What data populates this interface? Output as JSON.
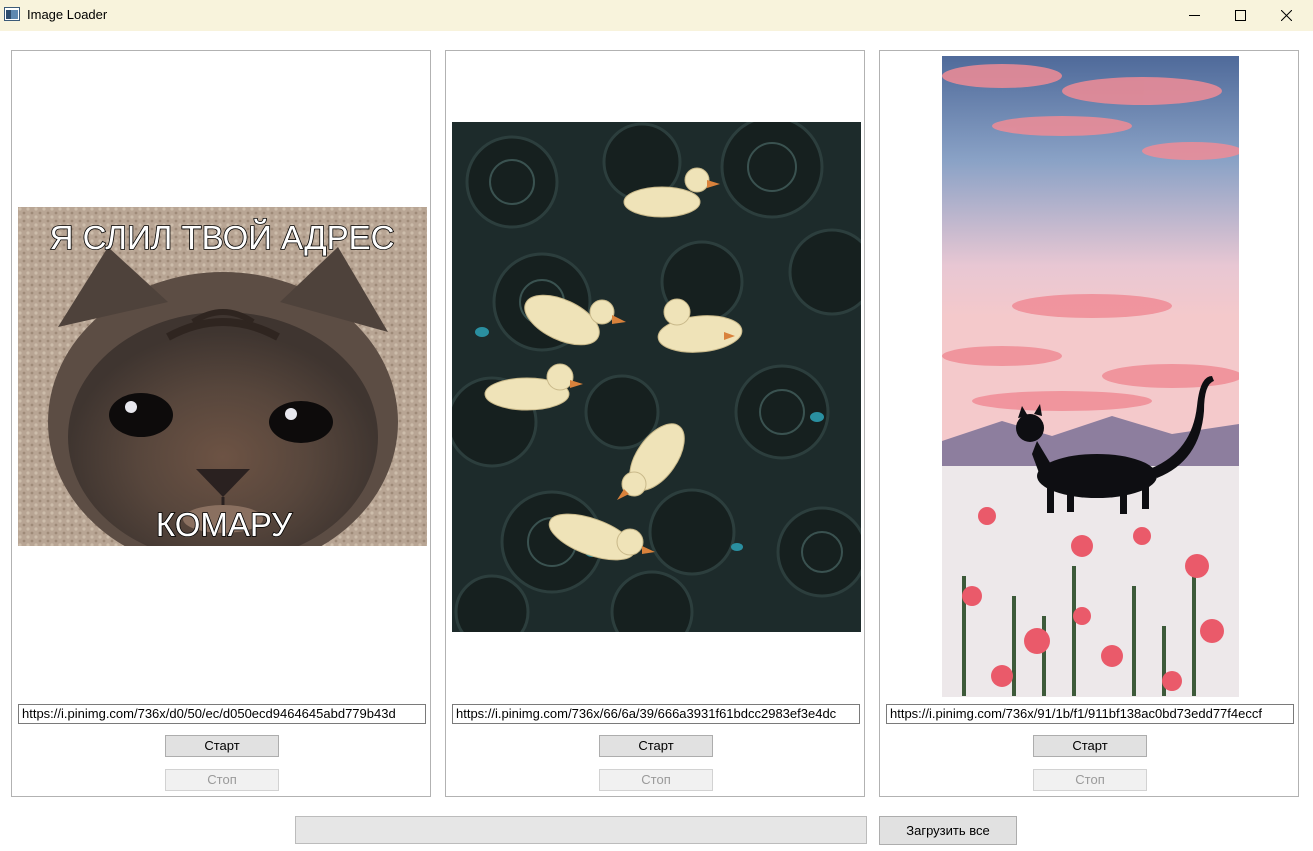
{
  "window": {
    "title": "Image Loader"
  },
  "panels": [
    {
      "url": "https://i.pinimg.com/736x/d0/50/ec/d050ecd9464645abd779b43d",
      "start_label": "Старт",
      "stop_label": "Стоп",
      "image_caption_top": "Я СЛИЛ ТВОЙ АДРЕС",
      "image_caption_bottom": "КОМАРУ"
    },
    {
      "url": "https://i.pinimg.com/736x/66/6a/39/666a3931f61bdcc2983ef3e4dc",
      "start_label": "Старт",
      "stop_label": "Стоп"
    },
    {
      "url": "https://i.pinimg.com/736x/91/1b/f1/911bf138ac0bd73edd77f4eccf",
      "start_label": "Старт",
      "stop_label": "Стоп"
    }
  ],
  "footer": {
    "load_all_label": "Загрузить все",
    "progress": 0
  },
  "colors": {
    "titlebar": "#f8f3dc",
    "button_face": "#e1e1e1",
    "progress_track": "#e6e6e6"
  },
  "icons": [
    "app-window-icon",
    "minimize-icon",
    "maximize-icon",
    "close-icon"
  ]
}
